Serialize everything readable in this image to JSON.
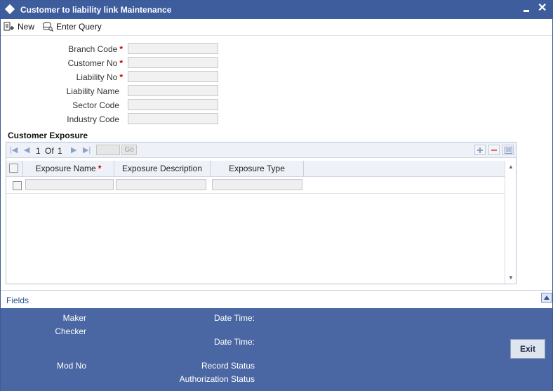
{
  "window": {
    "title": "Customer to liability link Maintenance"
  },
  "toolbar": {
    "new_label": "New",
    "enter_query_label": "Enter Query"
  },
  "form": {
    "fields": [
      {
        "label": "Branch Code",
        "required": true,
        "value": ""
      },
      {
        "label": "Customer No",
        "required": true,
        "value": ""
      },
      {
        "label": "Liability No",
        "required": true,
        "value": ""
      },
      {
        "label": "Liability Name",
        "required": false,
        "value": ""
      },
      {
        "label": "Sector Code",
        "required": false,
        "value": ""
      },
      {
        "label": "Industry Code",
        "required": false,
        "value": ""
      }
    ],
    "required_marker": "*"
  },
  "exposure": {
    "title": "Customer Exposure",
    "pager": {
      "current": "1",
      "of_label": "Of",
      "total": "1",
      "go_label": "Go"
    },
    "columns": [
      {
        "label": "Exposure Name",
        "required": true
      },
      {
        "label": "Exposure Description",
        "required": false
      },
      {
        "label": "Exposure Type",
        "required": false
      }
    ]
  },
  "fields_section": {
    "label": "Fields"
  },
  "audit": {
    "maker": "Maker",
    "checker": "Checker",
    "date_time_1": "Date Time:",
    "date_time_2": "Date Time:",
    "mod_no": "Mod No",
    "record_status": "Record Status",
    "authorization_status": "Authorization Status",
    "exit_label": "Exit"
  },
  "colors": {
    "titlebar": "#3d5d9d",
    "audit_panel": "#4a67a3",
    "required": "#cc0000"
  }
}
